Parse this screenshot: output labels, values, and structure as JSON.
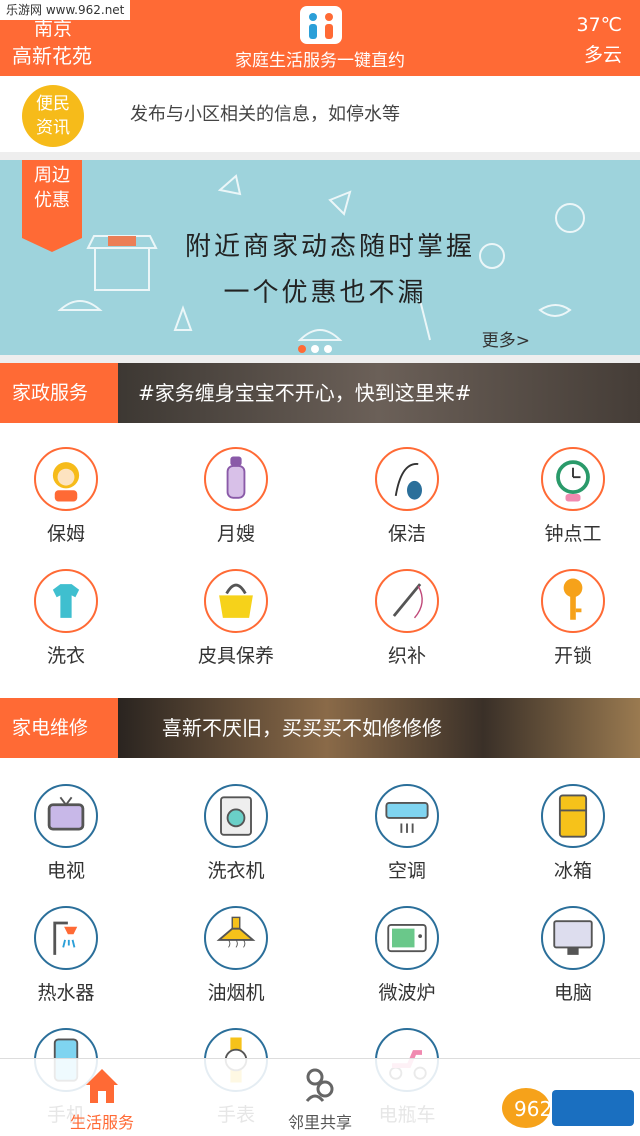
{
  "watermark_top": "乐游网 www.962.net",
  "header": {
    "location_line1": "南京",
    "location_line2": "高新花苑",
    "tagline": "家庭生活服务一键直约",
    "temperature": "37℃",
    "weather": "多云",
    "accent_color": "#ff6a35"
  },
  "notice": {
    "badge_line1": "便民",
    "badge_line2": "资讯",
    "text": "发布与小区相关的信息，如停水等"
  },
  "banner": {
    "tag_line1": "周边",
    "tag_line2": "优惠",
    "line1": "附近商家动态随时掌握",
    "line2": "一个优惠也不漏",
    "more": "更多>",
    "slide_index": 1,
    "slide_count": 3
  },
  "housekeeping": {
    "label": "家政服务",
    "slogan": "#家务缠身宝宝不开心，快到这里来#",
    "items": [
      {
        "label": "保姆",
        "icon": "nanny-icon"
      },
      {
        "label": "月嫂",
        "icon": "baby-bottle-icon"
      },
      {
        "label": "保洁",
        "icon": "vacuum-icon"
      },
      {
        "label": "钟点工",
        "icon": "clock-icon"
      },
      {
        "label": "洗衣",
        "icon": "tshirt-icon"
      },
      {
        "label": "皮具保养",
        "icon": "handbag-icon"
      },
      {
        "label": "织补",
        "icon": "needle-icon"
      },
      {
        "label": "开锁",
        "icon": "key-icon"
      }
    ]
  },
  "appliance": {
    "label": "家电维修",
    "slogan": "喜新不厌旧，买买买不如修修修",
    "items": [
      {
        "label": "电视",
        "icon": "tv-icon"
      },
      {
        "label": "洗衣机",
        "icon": "washing-machine-icon"
      },
      {
        "label": "空调",
        "icon": "air-conditioner-icon"
      },
      {
        "label": "冰箱",
        "icon": "fridge-icon"
      },
      {
        "label": "热水器",
        "icon": "shower-icon"
      },
      {
        "label": "油烟机",
        "icon": "range-hood-icon"
      },
      {
        "label": "微波炉",
        "icon": "microwave-icon"
      },
      {
        "label": "电脑",
        "icon": "computer-icon"
      },
      {
        "label": "手机",
        "icon": "phone-icon"
      },
      {
        "label": "手表",
        "icon": "watch-icon"
      },
      {
        "label": "电瓶车",
        "icon": "scooter-icon"
      }
    ]
  },
  "nav": {
    "items": [
      {
        "label": "生活服务",
        "icon": "home-icon",
        "active": true
      },
      {
        "label": "邻里共享",
        "icon": "people-icon",
        "active": false
      }
    ]
  },
  "watermark_bottom": "962.NET 乐游网"
}
